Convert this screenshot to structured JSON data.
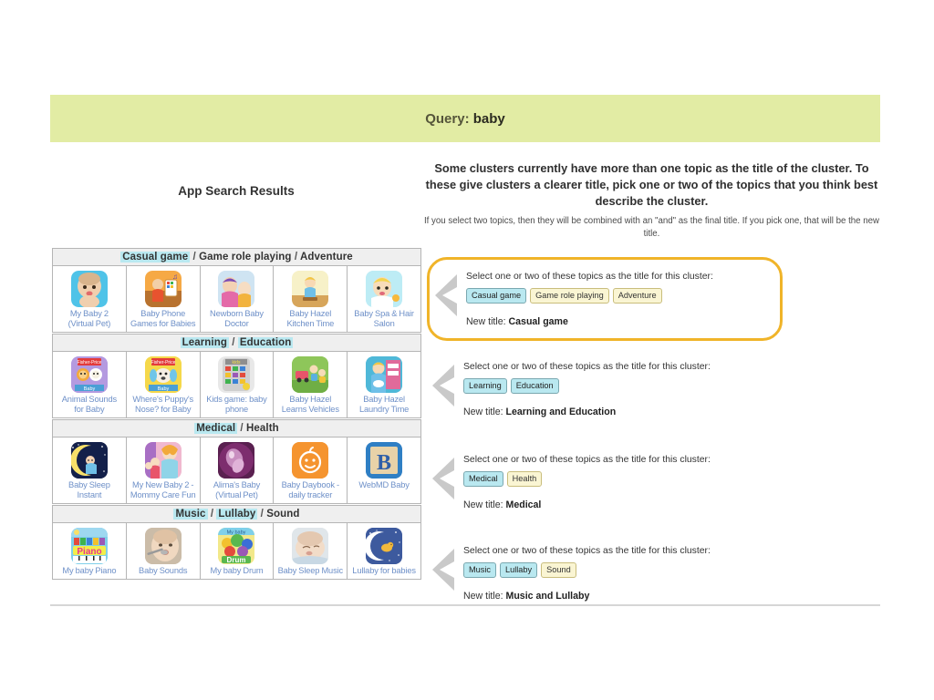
{
  "query": {
    "label": "Query:",
    "value": "baby"
  },
  "left": {
    "title": "App Search Results"
  },
  "instructions": {
    "main": "Some clusters currently have more than one topic as the title of the cluster. To these give clusters a clearer title, pick one or two of the topics that you think best describe the cluster.",
    "sub": "If you select two topics, then they will be combined with an \"and\" as the final title. If you pick one, that will be the new title."
  },
  "panel_common": {
    "prompt": "Select one or two of these topics as the title for this cluster:",
    "newtitle_label": "New title: "
  },
  "colors": {
    "banner": "#e2eca4",
    "selected_chip_bg": "#b9e8f0",
    "unselected_chip_bg": "#faf5d3",
    "highlight_border": "#f0b429",
    "chevron": "#c9c9c9",
    "app_name": "#6e90c8"
  },
  "clusters": [
    {
      "topics": [
        {
          "label": "Casual game",
          "selected": true
        },
        {
          "label": "Game role playing",
          "selected": false
        },
        {
          "label": "Adventure",
          "selected": false
        }
      ],
      "new_title": "Casual game",
      "panel_highlighted": true,
      "apps": [
        {
          "name": "My Baby 2 (Virtual Pet)",
          "line1": "My Baby 2",
          "line2": "(Virtual Pet)",
          "icon": "baby-face-blue"
        },
        {
          "name": "Baby Phone Games for Babies",
          "line1": "Baby Phone",
          "line2": "Games for Babies",
          "icon": "baby-phone-orange"
        },
        {
          "name": "Newborn Baby Doctor",
          "line1": "Newborn Baby",
          "line2": "Doctor",
          "icon": "newborn-doctor"
        },
        {
          "name": "Baby Hazel Kitchen Time",
          "line1": "Baby Hazel",
          "line2": "Kitchen Time",
          "icon": "hazel-kitchen"
        },
        {
          "name": "Baby Spa & Hair Salon",
          "line1": "Baby Spa & Hair",
          "line2": "Salon",
          "icon": "baby-spa-salon"
        }
      ]
    },
    {
      "topics": [
        {
          "label": "Learning",
          "selected": true
        },
        {
          "label": "Education",
          "selected": true
        }
      ],
      "new_title": "Learning and Education",
      "panel_highlighted": false,
      "apps": [
        {
          "name": "Animal Sounds for Baby",
          "line1": "Animal Sounds",
          "line2": "for Baby",
          "icon": "animal-sounds"
        },
        {
          "name": "Where's Puppy's Nose? for Baby",
          "line1": "Where's Puppy's",
          "line2": "Nose? for Baby",
          "icon": "puppy-nose"
        },
        {
          "name": "Kids game: baby phone",
          "line1": "Kids game: baby",
          "line2": "phone",
          "icon": "kids-phone-grid"
        },
        {
          "name": "Baby Hazel Learns Vehicles",
          "line1": "Baby Hazel",
          "line2": "Learns Vehicles",
          "icon": "hazel-vehicles"
        },
        {
          "name": "Baby Hazel Laundry Time",
          "line1": "Baby Hazel",
          "line2": "Laundry Time",
          "icon": "hazel-laundry"
        }
      ]
    },
    {
      "topics": [
        {
          "label": "Medical",
          "selected": true
        },
        {
          "label": "Health",
          "selected": false
        }
      ],
      "new_title": "Medical",
      "panel_highlighted": false,
      "apps": [
        {
          "name": "Baby Sleep Instant",
          "line1": "Baby Sleep",
          "line2": "Instant",
          "icon": "moon-baby"
        },
        {
          "name": "My New Baby 2 - Mommy Care Fun",
          "line1": "My New Baby 2 -",
          "line2": "Mommy Care Fun",
          "icon": "mommy-care"
        },
        {
          "name": "Alima's Baby (Virtual Pet)",
          "line1": "Alima's Baby",
          "line2": "(Virtual Pet)",
          "icon": "alima-purple"
        },
        {
          "name": "Baby Daybook - daily tracker",
          "line1": "Baby Daybook -",
          "line2": "daily tracker",
          "icon": "daybook-orange"
        },
        {
          "name": "WebMD Baby",
          "line1": "WebMD Baby",
          "line2": "",
          "icon": "webmd-block"
        }
      ]
    },
    {
      "topics": [
        {
          "label": "Music",
          "selected": true
        },
        {
          "label": "Lullaby",
          "selected": true
        },
        {
          "label": "Sound",
          "selected": false
        }
      ],
      "new_title": "Music and Lullaby",
      "panel_highlighted": false,
      "apps": [
        {
          "name": "My baby Piano",
          "line1": "My baby Piano",
          "line2": "",
          "icon": "piano-app"
        },
        {
          "name": "Baby Sounds",
          "line1": "Baby Sounds",
          "line2": "",
          "icon": "baby-photo-spoon"
        },
        {
          "name": "My baby Drum",
          "line1": "My baby Drum",
          "line2": "",
          "icon": "drum-app"
        },
        {
          "name": "Baby Sleep Music",
          "line1": "Baby Sleep Music",
          "line2": "",
          "icon": "sleeping-baby-photo"
        },
        {
          "name": "Lullaby for babies",
          "line1": "Lullaby for babies",
          "line2": "",
          "icon": "lullaby-moon"
        }
      ]
    }
  ]
}
